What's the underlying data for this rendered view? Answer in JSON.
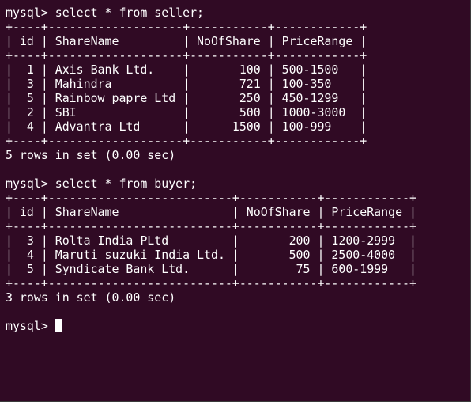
{
  "terminal": {
    "background": "#300a24",
    "foreground": "#ffffff",
    "lines": [
      "mysql> select * from seller;",
      "+----+-------------------+-----------+------------+",
      "| id | ShareName         | NoOfShare | PriceRange |",
      "+----+-------------------+-----------+------------+",
      "|  1 | Axis Bank Ltd.    |       100 | 500-1500   |",
      "|  3 | Mahindra          |       721 | 100-350    |",
      "|  5 | Rainbow papre Ltd |       250 | 450-1299   |",
      "|  2 | SBI               |       500 | 1000-3000  |",
      "|  4 | Advantra Ltd      |      1500 | 100-999    |",
      "+----+-------------------+-----------+------------+",
      "5 rows in set (0.00 sec)",
      "",
      "mysql> select * from buyer;",
      "+----+--------------------------+-----------+------------+",
      "| id | ShareName                | NoOfShare | PriceRange |",
      "+----+--------------------------+-----------+------------+",
      "|  3 | Rolta India PLtd         |       200 | 1200-2999  |",
      "|  4 | Maruti suzuki India Ltd. |       500 | 2500-4000  |",
      "|  5 | Syndicate Bank Ltd.      |        75 | 600-1999   |",
      "+----+--------------------------+-----------+------------+",
      "3 rows in set (0.00 sec)",
      "",
      "mysql> "
    ]
  }
}
